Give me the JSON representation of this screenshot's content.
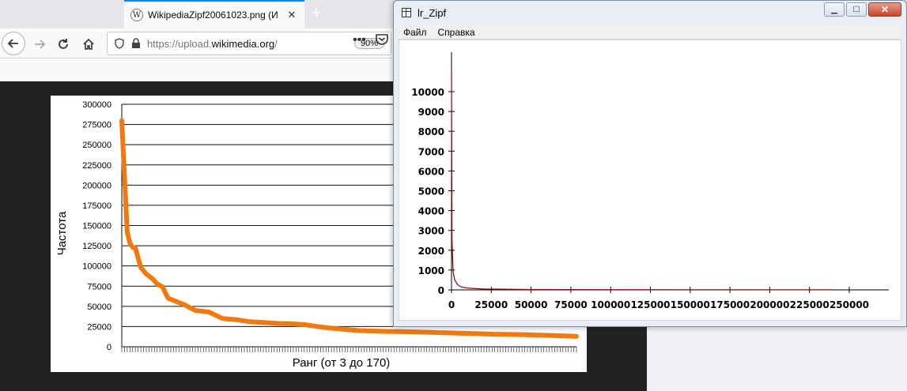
{
  "browser": {
    "tab": {
      "title": "WikipediaZipf20061023.png (И",
      "favicon": "wikipedia-globe-icon",
      "close": "✕"
    },
    "new_tab": "+",
    "url": {
      "prefix": "https://upload.",
      "domain": "wikimedia.org",
      "suffix": "/"
    },
    "zoom": "90%",
    "page_actions_icon": "•••",
    "pocket_icon": "pocket-icon"
  },
  "zipf_image": {
    "chart_data": {
      "type": "line",
      "title": "",
      "xlabel": "Ранг (от 3 до 170)",
      "ylabel": "Частота",
      "ylim": [
        0,
        300000
      ],
      "yticks": [
        "300000",
        "275000",
        "250000",
        "225000",
        "200000",
        "175000",
        "150000",
        "125000",
        "100000",
        "75000",
        "50000",
        "25000",
        "0"
      ],
      "yvalues": [
        300000,
        275000,
        250000,
        225000,
        200000,
        175000,
        150000,
        125000,
        100000,
        75000,
        50000,
        25000,
        0
      ],
      "xlim": [
        3,
        170
      ],
      "grid": true,
      "color": "#f07a10",
      "series": [
        {
          "x": [
            3,
            4,
            5,
            6,
            7,
            8,
            9,
            10,
            12,
            14,
            16,
            18,
            20,
            23,
            26,
            30,
            35,
            40,
            45,
            50,
            55,
            60,
            65,
            70,
            75,
            80,
            85,
            90,
            95,
            100,
            110,
            120,
            130,
            140,
            150,
            160,
            170
          ],
          "values": [
            280000,
            210000,
            142000,
            128000,
            123000,
            122000,
            110000,
            98000,
            90000,
            85000,
            78000,
            74000,
            60000,
            56000,
            52000,
            45000,
            43000,
            35000,
            33500,
            31000,
            30000,
            29000,
            28500,
            27500,
            25000,
            23000,
            21500,
            20000,
            19500,
            19000,
            18500,
            17500,
            16500,
            15500,
            15000,
            14000,
            13000
          ]
        }
      ]
    }
  },
  "window": {
    "title": "lr_Zipf",
    "menu": [
      "Файл",
      "Справка"
    ],
    "minimize": "▁",
    "maximize": "☐",
    "close": "✕",
    "chart_data": {
      "type": "line",
      "title": "",
      "xlabel": "",
      "ylabel": "",
      "xlim": [
        0,
        260000
      ],
      "ylim": [
        0,
        11000
      ],
      "xticks": [
        0,
        25000,
        50000,
        75000,
        100000,
        125000,
        150000,
        175000,
        200000,
        225000,
        250000
      ],
      "yticks": [
        0,
        1000,
        2000,
        3000,
        4000,
        5000,
        6000,
        7000,
        8000,
        9000,
        10000
      ],
      "color": "#8b0000",
      "series": [
        {
          "x": [
            1,
            300,
            1000,
            2000,
            4000,
            6000,
            10000,
            20000,
            50000,
            100000,
            150000,
            200000,
            240000
          ],
          "values": [
            11000,
            2500,
            900,
            500,
            250,
            150,
            90,
            45,
            20,
            12,
            8,
            6,
            5
          ]
        }
      ]
    }
  }
}
